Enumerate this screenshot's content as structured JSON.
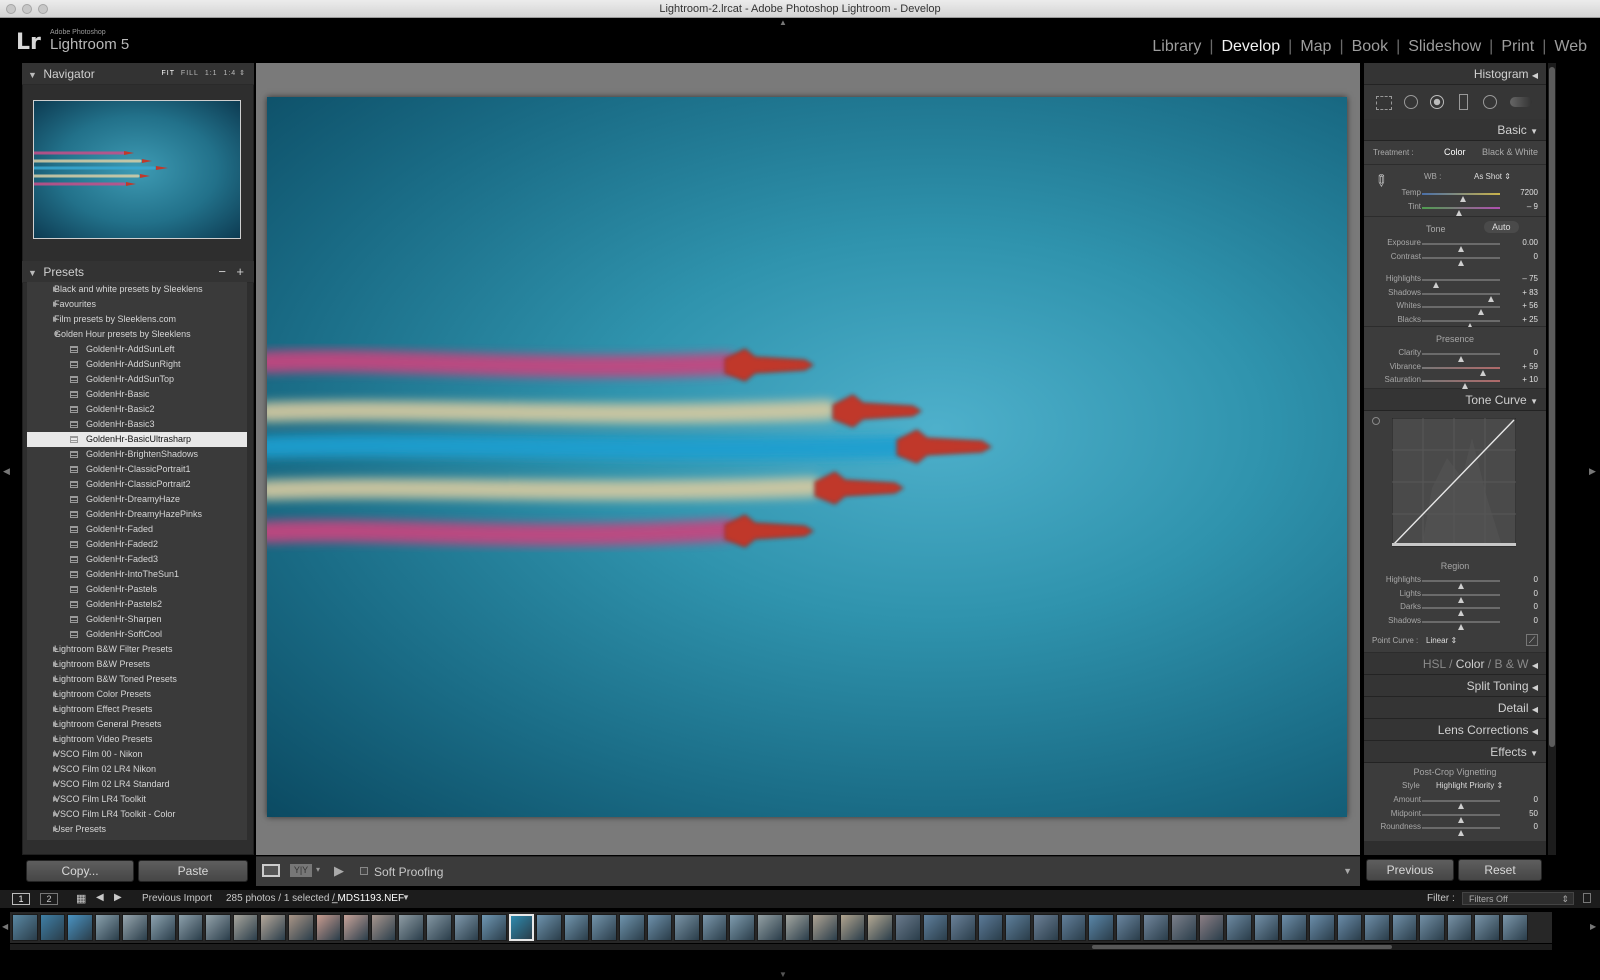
{
  "window": {
    "title": "Lightroom-2.lrcat - Adobe Photoshop Lightroom - Develop"
  },
  "identity": {
    "logo": "Lr",
    "company": "Adobe Photoshop",
    "product": "Lightroom 5"
  },
  "modules": [
    {
      "label": "Library",
      "active": false
    },
    {
      "label": "Develop",
      "active": true
    },
    {
      "label": "Map",
      "active": false
    },
    {
      "label": "Book",
      "active": false
    },
    {
      "label": "Slideshow",
      "active": false
    },
    {
      "label": "Print",
      "active": false
    },
    {
      "label": "Web",
      "active": false
    }
  ],
  "navigator": {
    "title": "Navigator",
    "zoom": [
      "FIT",
      "FILL",
      "1:1",
      "1:4"
    ]
  },
  "presets": {
    "title": "Presets",
    "items": [
      {
        "label": "Black and white presets by Sleeklens",
        "kind": "folder",
        "open": false
      },
      {
        "label": "Favourites",
        "kind": "folder",
        "open": false
      },
      {
        "label": "Film presets by Sleeklens.com",
        "kind": "folder",
        "open": false
      },
      {
        "label": "Golden Hour presets by Sleeklens",
        "kind": "folder",
        "open": true
      },
      {
        "label": "GoldenHr-AddSunLeft",
        "kind": "preset"
      },
      {
        "label": "GoldenHr-AddSunRight",
        "kind": "preset"
      },
      {
        "label": "GoldenHr-AddSunTop",
        "kind": "preset"
      },
      {
        "label": "GoldenHr-Basic",
        "kind": "preset"
      },
      {
        "label": "GoldenHr-Basic2",
        "kind": "preset"
      },
      {
        "label": "GoldenHr-Basic3",
        "kind": "preset"
      },
      {
        "label": "GoldenHr-BasicUltrasharp",
        "kind": "preset",
        "selected": true
      },
      {
        "label": "GoldenHr-BrightenShadows",
        "kind": "preset"
      },
      {
        "label": "GoldenHr-ClassicPortrait1",
        "kind": "preset"
      },
      {
        "label": "GoldenHr-ClassicPortrait2",
        "kind": "preset"
      },
      {
        "label": "GoldenHr-DreamyHaze",
        "kind": "preset"
      },
      {
        "label": "GoldenHr-DreamyHazePinks",
        "kind": "preset"
      },
      {
        "label": "GoldenHr-Faded",
        "kind": "preset"
      },
      {
        "label": "GoldenHr-Faded2",
        "kind": "preset"
      },
      {
        "label": "GoldenHr-Faded3",
        "kind": "preset"
      },
      {
        "label": "GoldenHr-IntoTheSun1",
        "kind": "preset"
      },
      {
        "label": "GoldenHr-Pastels",
        "kind": "preset"
      },
      {
        "label": "GoldenHr-Pastels2",
        "kind": "preset"
      },
      {
        "label": "GoldenHr-Sharpen",
        "kind": "preset"
      },
      {
        "label": "GoldenHr-SoftCool",
        "kind": "preset"
      },
      {
        "label": "Lightroom B&W Filter Presets",
        "kind": "folder",
        "open": false
      },
      {
        "label": "Lightroom B&W Presets",
        "kind": "folder",
        "open": false
      },
      {
        "label": "Lightroom B&W Toned Presets",
        "kind": "folder",
        "open": false
      },
      {
        "label": "Lightroom Color Presets",
        "kind": "folder",
        "open": false
      },
      {
        "label": "Lightroom Effect Presets",
        "kind": "folder",
        "open": false
      },
      {
        "label": "Lightroom General Presets",
        "kind": "folder",
        "open": false
      },
      {
        "label": "Lightroom Video Presets",
        "kind": "folder",
        "open": false
      },
      {
        "label": "VSCO Film 00 - Nikon",
        "kind": "folder",
        "open": false
      },
      {
        "label": "VSCO Film 02 LR4 Nikon",
        "kind": "folder",
        "open": false
      },
      {
        "label": "VSCO Film 02 LR4 Standard",
        "kind": "folder",
        "open": false
      },
      {
        "label": "VSCO Film LR4 Toolkit",
        "kind": "folder",
        "open": false
      },
      {
        "label": "VSCO Film LR4 Toolkit - Color",
        "kind": "folder",
        "open": false
      },
      {
        "label": "User Presets",
        "kind": "folder",
        "open": false
      }
    ]
  },
  "left_buttons": {
    "copy": "Copy...",
    "paste": "Paste"
  },
  "toolbar": {
    "soft_proofing": "Soft Proofing"
  },
  "right": {
    "histogram": "Histogram",
    "basic": "Basic",
    "treatment_label": "Treatment :",
    "treatment_color": "Color",
    "treatment_bw": "Black & White",
    "wb_label": "WB :",
    "wb_value": "As Shot",
    "tone_label": "Tone",
    "auto": "Auto",
    "presence_label": "Presence",
    "wb_sliders": [
      {
        "label": "Temp",
        "value": "7200",
        "pos": 0.52
      },
      {
        "label": "Tint",
        "value": "– 9",
        "pos": 0.47
      }
    ],
    "tone_sliders": [
      {
        "label": "Exposure",
        "value": "0.00",
        "pos": 0.5
      },
      {
        "label": "Contrast",
        "value": "0",
        "pos": 0.5
      }
    ],
    "tone_sliders2": [
      {
        "label": "Highlights",
        "value": "– 75",
        "pos": 0.18
      },
      {
        "label": "Shadows",
        "value": "+ 83",
        "pos": 0.88
      },
      {
        "label": "Whites",
        "value": "+ 56",
        "pos": 0.76
      },
      {
        "label": "Blacks",
        "value": "+ 25",
        "pos": 0.62
      }
    ],
    "presence_sliders": [
      {
        "label": "Clarity",
        "value": "0",
        "pos": 0.5
      },
      {
        "label": "Vibrance",
        "value": "+ 59",
        "pos": 0.78
      },
      {
        "label": "Saturation",
        "value": "+ 10",
        "pos": 0.55
      }
    ],
    "tone_curve": "Tone Curve",
    "region_label": "Region",
    "region_sliders": [
      {
        "label": "Highlights",
        "value": "0",
        "pos": 0.5
      },
      {
        "label": "Lights",
        "value": "0",
        "pos": 0.5
      },
      {
        "label": "Darks",
        "value": "0",
        "pos": 0.5
      },
      {
        "label": "Shadows",
        "value": "0",
        "pos": 0.5
      }
    ],
    "point_curve_label": "Point Curve :",
    "point_curve_value": "Linear",
    "hsl": "HSL",
    "color": "Color",
    "bw": "B & W",
    "split_toning": "Split Toning",
    "detail": "Detail",
    "lens_corrections": "Lens Corrections",
    "effects": "Effects",
    "post_crop": "Post-Crop Vignetting",
    "style_label": "Style",
    "style_value": "Highlight Priority",
    "effects_sliders": [
      {
        "label": "Amount",
        "value": "0",
        "pos": 0.5
      },
      {
        "label": "Midpoint",
        "value": "50",
        "pos": 0.5
      },
      {
        "label": "Roundness",
        "value": "0",
        "pos": 0.5
      }
    ],
    "previous": "Previous",
    "reset": "Reset"
  },
  "filmstrip_bar": {
    "screen1": "1",
    "screen2": "2",
    "source": "Previous Import",
    "count": "285 photos / 1 selected /",
    "filename": "_MDS1193.NEF",
    "filter_label": "Filter :",
    "filter_value": "Filters Off"
  },
  "filmstrip": {
    "thumb_colors": [
      "#5a88a3",
      "#3f7fa6",
      "#4a93c2",
      "#8aa1ad",
      "#97a6ae",
      "#8da3b0",
      "#8da0ab",
      "#93a2aa",
      "#a7a59c",
      "#b5a89a",
      "#a99586",
      "#c89c8f",
      "#c7a399",
      "#a7968e",
      "#8e9ca4",
      "#8497a3",
      "#7f98ab",
      "#6f97b3",
      "#2e8aae",
      "#6e93ad",
      "#7296ae",
      "#7394ab",
      "#6f94ad",
      "#6e91ab",
      "#7a94a6",
      "#7b97ab",
      "#7f9cae",
      "#94a0a4",
      "#a3a6a0",
      "#aea393",
      "#b1a48e",
      "#b3a892",
      "#6a7a8c",
      "#5f7f9c",
      "#6a8199",
      "#5b7a98",
      "#5e7f9b",
      "#6c8096",
      "#627f9a",
      "#5a86a8",
      "#6a86a0",
      "#71869c",
      "#7b7f8a",
      "#8b7e84",
      "#6d8aa2",
      "#7390a8",
      "#6d8ea9",
      "#6b8eab",
      "#6a8ca9",
      "#6e8ea8",
      "#708fa7",
      "#7390a6",
      "#7892a6",
      "#7994a8",
      "#7b96aa"
    ]
  }
}
